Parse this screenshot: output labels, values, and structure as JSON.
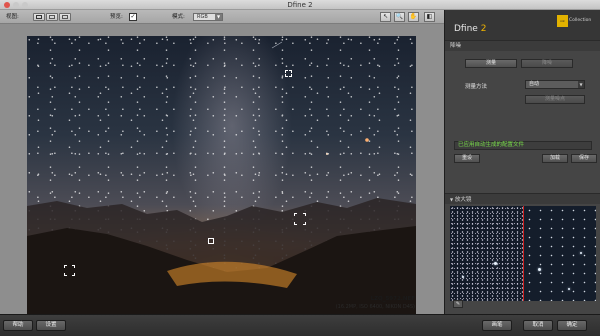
{
  "window": {
    "title": "Dfine 2"
  },
  "toolbar": {
    "view_label": "视图:",
    "preview_label": "预览:",
    "mode_label": "模式:",
    "mode_value": "RGB"
  },
  "image": {
    "filename": "LZQ_5972.NEF",
    "info": "(16.2MP, ISO 6400, NIKON D4S)"
  },
  "panel": {
    "app_name": "Dfine",
    "app_version": "2",
    "badge_text": "Collection",
    "section_noise": "降噪",
    "btn_measure": "测量",
    "btn_reduce": "降噪",
    "method_label": "测量方法",
    "method_value": "自动",
    "btn_measure_noise": "测量噪点",
    "status_text": "已应用自动生成的配置文件",
    "btn_reset": "重设",
    "btn_load": "加载",
    "btn_save": "保存",
    "section_loupe": "放大镜"
  },
  "bottom": {
    "help": "帮助",
    "settings": "设置",
    "brush": "画笔",
    "cancel": "取消",
    "ok": "确定"
  },
  "colors": {
    "accent": "#f0b400",
    "status": "#7adf4a",
    "loupe_split": "#d02020"
  }
}
